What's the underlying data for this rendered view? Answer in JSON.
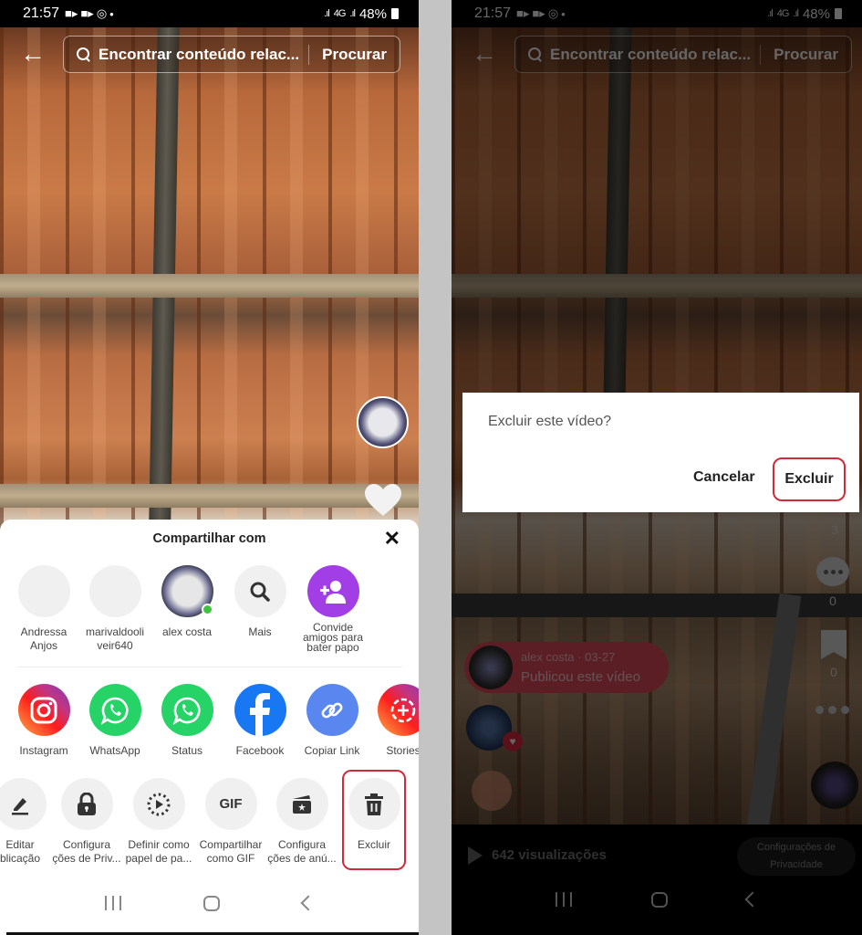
{
  "status_bar": {
    "time": "21:57",
    "network": "4G",
    "battery": "48%"
  },
  "top_bar": {
    "search_placeholder": "Encontrar conteúdo relac...",
    "search_button": "Procurar"
  },
  "share_sheet": {
    "title": "Compartilhar com",
    "contacts": [
      {
        "label": "Andressa\nAnjos",
        "line1": "Andressa",
        "line2": "Anjos"
      },
      {
        "label": "marivaldooliveir640",
        "line1": "marivaldooli",
        "line2": "veir640"
      },
      {
        "label": "alex costa",
        "line1": "alex costa",
        "line2": "",
        "online": true
      },
      {
        "label": "Mais",
        "line1": "Mais",
        "line2": ""
      },
      {
        "label": "Convide amigos para bater papo",
        "line1": "Convide",
        "line2": "amigos para",
        "line3": "bater papo"
      }
    ],
    "apps": [
      {
        "label": "Instagram",
        "icon": "instagram-icon"
      },
      {
        "label": "WhatsApp",
        "icon": "whatsapp-icon"
      },
      {
        "label": "Status",
        "icon": "whatsapp-status-icon"
      },
      {
        "label": "Facebook",
        "icon": "facebook-icon"
      },
      {
        "label": "Copiar Link",
        "icon": "link-icon"
      },
      {
        "label": "Stories",
        "icon": "stories-icon"
      }
    ],
    "actions": [
      {
        "line1": "Editar",
        "line2": "blicação",
        "icon": "edit-icon"
      },
      {
        "line1": "Configura",
        "line2": "ções de Priv...",
        "icon": "lock-icon"
      },
      {
        "line1": "Definir como",
        "line2": "papel de pa...",
        "icon": "live-wallpaper-icon"
      },
      {
        "line1": "Compartilhar",
        "line2": "como GIF",
        "icon": "gif-icon",
        "glyph": "GIF"
      },
      {
        "line1": "Configura",
        "line2": "ções de anú...",
        "icon": "ad-settings-icon"
      },
      {
        "line1": "Excluir",
        "line2": "",
        "icon": "trash-icon"
      }
    ]
  },
  "dialog": {
    "title": "Excluir este vídeo?",
    "cancel": "Cancelar",
    "confirm": "Excluir"
  },
  "video_overlay": {
    "like_count": "3",
    "comment_count": "0",
    "bookmark_count": "0",
    "publisher": "alex costa · 03-27",
    "published_text": "Publicou este vídeo",
    "views": "642 visualizações",
    "privacy_button": "Configurações de Privacidade",
    "privacy_line1": "Configurações de",
    "privacy_line2": "Privacidade"
  },
  "colors": {
    "accent_red": "#d12b3a",
    "invite_purple": "#a23ee6",
    "whatsapp_green": "#25d366",
    "facebook_blue": "#1877f2",
    "link_blue": "#5a86f0",
    "online_green": "#3ec43e"
  }
}
